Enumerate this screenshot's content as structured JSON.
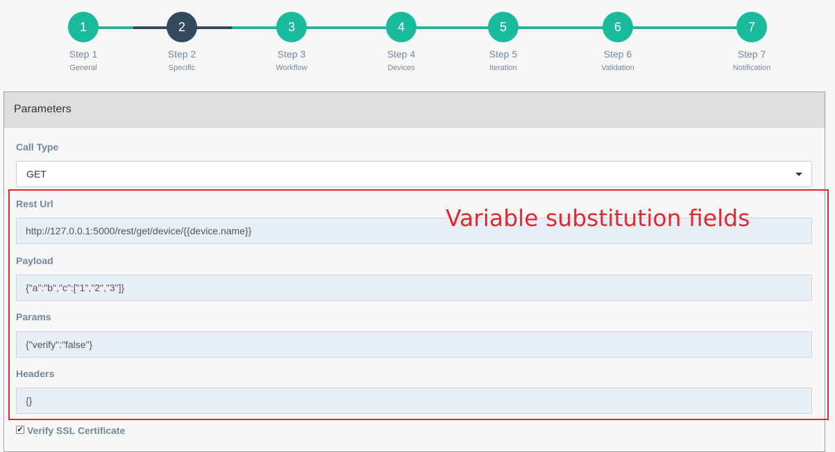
{
  "stepper": {
    "line_color_active": "#1abb9c",
    "line_color_current": "#34495e",
    "steps": [
      {
        "number": "1",
        "title": "Step 1",
        "subtitle": "General",
        "color": "#1abb9c"
      },
      {
        "number": "2",
        "title": "Step 2",
        "subtitle": "Specific",
        "color": "#34495e"
      },
      {
        "number": "3",
        "title": "Step 3",
        "subtitle": "Workflow",
        "color": "#1abb9c"
      },
      {
        "number": "4",
        "title": "Step 4",
        "subtitle": "Devices",
        "color": "#1abb9c"
      },
      {
        "number": "5",
        "title": "Step 5",
        "subtitle": "Iteration",
        "color": "#1abb9c"
      },
      {
        "number": "6",
        "title": "Step 6",
        "subtitle": "Validation",
        "color": "#1abb9c"
      },
      {
        "number": "7",
        "title": "Step 7",
        "subtitle": "Notification",
        "color": "#1abb9c"
      }
    ],
    "current_step": 2
  },
  "panel": {
    "title": "Parameters",
    "call_type": {
      "label": "Call Type",
      "value": "GET"
    },
    "rest_url": {
      "label": "Rest Url",
      "value": "http://127.0.0.1:5000/rest/get/device/{{device.name}}"
    },
    "payload": {
      "label": "Payload",
      "value": "{\"a\":\"b\",\"c\":[\"1\",\"2\",\"3\"]}"
    },
    "params": {
      "label": "Params",
      "value": "{\"verify\":\"false\"}"
    },
    "headers": {
      "label": "Headers",
      "value": "{}"
    },
    "verify_ssl": {
      "label": "Verify SSL Certificate",
      "checked": true,
      "check_glyph": "✔"
    }
  },
  "annotation": {
    "text": "Variable substitution fields",
    "color": "#e0282e"
  }
}
